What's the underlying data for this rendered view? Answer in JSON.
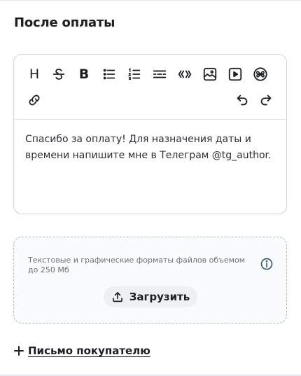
{
  "section": {
    "title": "После оплаты"
  },
  "toolbar": {
    "heading_label": "H",
    "bold_label": "B"
  },
  "editor": {
    "content": "Спасибо за оплату! Для назначения даты и времени напишите мне в Телеграм @tg_author."
  },
  "upload": {
    "hint": "Текстовые и графические форматы файлов объемом до 250 Мб",
    "button_label": "Загрузить"
  },
  "buyer_letter": {
    "label": "Письмо покупателю"
  },
  "colors": {
    "text": "#1b1f24",
    "border": "#c9d6de",
    "dashed_border": "#a9bcc8",
    "button_bg": "#eef1f4",
    "info": "#3d5a6c"
  }
}
